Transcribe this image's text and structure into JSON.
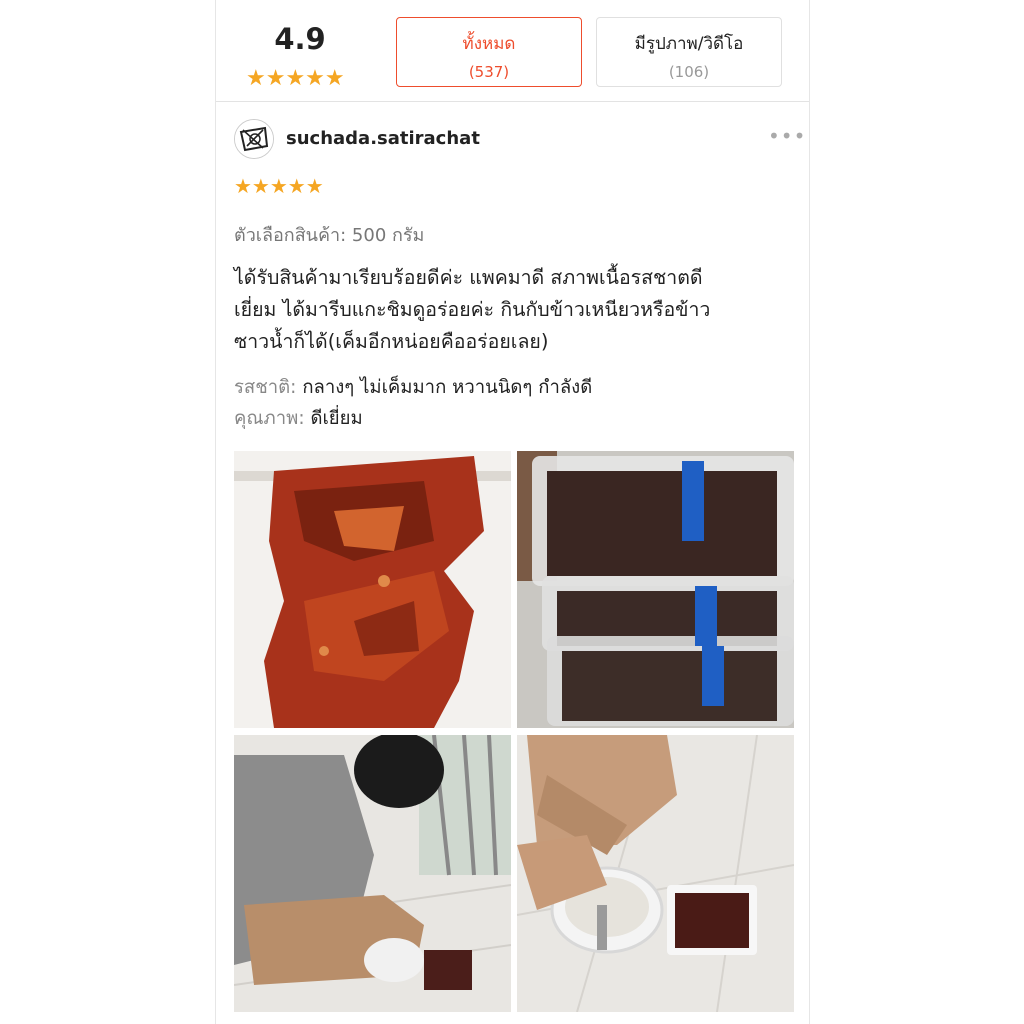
{
  "summary": {
    "rating": "4.9",
    "stars": "★★★★★",
    "filters": [
      {
        "label": "ทั้งหมด",
        "count": "(537)"
      },
      {
        "label": "มีรูปภาพ/วิดีโอ",
        "count": "(106)"
      }
    ]
  },
  "review": {
    "username": "suchada.satirachat",
    "more": "•••",
    "stars": "★★★★★",
    "variant": "ตัวเลือกสินค้า: 500 กรัม",
    "comment_lines": [
      "ได้รับสินค้ามาเรียบร้อยดีค่ะ แพคมาดี สภาพเนื้อรสชาตดี",
      "เยี่ยม ได้มารีบแกะชิมดูอร่อยค่ะ กินกับข้าวเหนียวหรือข้าว",
      "ซาวน้ำก็ได้(เค็มอีกหน่อยคืออร่อยเลย)"
    ],
    "attributes": [
      {
        "key": "รสชาติ: ",
        "value": "กลางๆ ไม่เค็มมาก หวานนิดๆ กำลังดี"
      },
      {
        "key": "คุณภาพ: ",
        "value": "ดีเยี่ยม"
      }
    ]
  },
  "colors": {
    "accent": "#ee4d2d",
    "star": "#f5a623"
  }
}
